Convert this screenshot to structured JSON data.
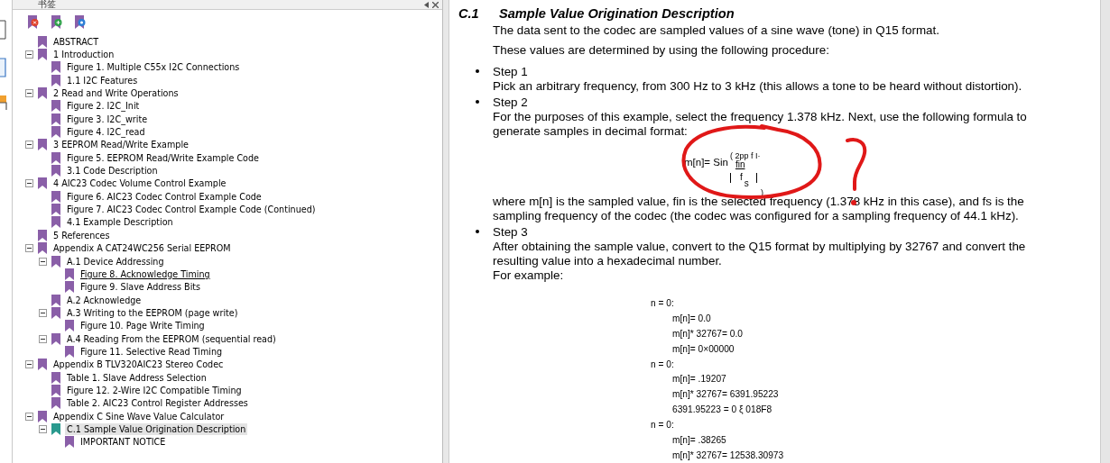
{
  "sidebar": {
    "title": "书签",
    "items": [
      {
        "label": "ABSTRACT",
        "selected": false,
        "hovered": false
      },
      {
        "label": "1 Introduction",
        "selected": false,
        "hovered": false,
        "expanded": true,
        "children": [
          {
            "label": "Figure 1. Multiple C55x I2C Connections",
            "selected": false,
            "hovered": false
          },
          {
            "label": "1.1 I2C Features",
            "selected": false,
            "hovered": false
          }
        ]
      },
      {
        "label": "2 Read and Write Operations",
        "selected": false,
        "hovered": false,
        "expanded": true,
        "children": [
          {
            "label": "Figure 2. I2C_Init",
            "selected": false,
            "hovered": false
          },
          {
            "label": "Figure 3. I2C_write",
            "selected": false,
            "hovered": false
          },
          {
            "label": "Figure 4. I2C_read",
            "selected": false,
            "hovered": false
          }
        ]
      },
      {
        "label": "3 EEPROM Read/Write Example",
        "selected": false,
        "hovered": false,
        "expanded": true,
        "children": [
          {
            "label": "Figure 5. EEPROM Read/Write Example Code",
            "selected": false,
            "hovered": false
          },
          {
            "label": "3.1 Code Description",
            "selected": false,
            "hovered": false
          }
        ]
      },
      {
        "label": "4 AIC23 Codec Volume Control Example",
        "selected": false,
        "hovered": false,
        "expanded": true,
        "children": [
          {
            "label": "Figure 6. AIC23 Codec Control Example Code",
            "selected": false,
            "hovered": false
          },
          {
            "label": "Figure 7. AIC23 Codec Control Example Code (Continued)",
            "selected": false,
            "hovered": false
          },
          {
            "label": "4.1 Example Description",
            "selected": false,
            "hovered": false
          }
        ]
      },
      {
        "label": "5 References",
        "selected": false,
        "hovered": false
      },
      {
        "label": "Appendix A CAT24WC256 Serial EEPROM",
        "selected": false,
        "hovered": false,
        "expanded": true,
        "children": [
          {
            "label": "A.1 Device Addressing",
            "selected": false,
            "hovered": false,
            "expanded": true,
            "children": [
              {
                "label": "Figure 8. Acknowledge Timing",
                "selected": false,
                "hovered": true
              },
              {
                "label": "Figure 9. Slave Address Bits",
                "selected": false,
                "hovered": false
              }
            ]
          },
          {
            "label": "A.2 Acknowledge",
            "selected": false,
            "hovered": false
          },
          {
            "label": "A.3 Writing to the EEPROM (page write)",
            "selected": false,
            "hovered": false,
            "expanded": true,
            "children": [
              {
                "label": "Figure 10. Page Write Timing",
                "selected": false,
                "hovered": false
              }
            ]
          },
          {
            "label": "A.4 Reading From the EEPROM (sequential read)",
            "selected": false,
            "hovered": false,
            "expanded": true,
            "children": [
              {
                "label": "Figure 11. Selective Read Timing",
                "selected": false,
                "hovered": false
              }
            ]
          }
        ]
      },
      {
        "label": "Appendix B TLV320AIC23 Stereo Codec",
        "selected": false,
        "hovered": false,
        "expanded": true,
        "children": [
          {
            "label": "Table 1. Slave Address Selection",
            "selected": false,
            "hovered": false
          },
          {
            "label": "Figure 12. 2-Wire I2C Compatible Timing",
            "selected": false,
            "hovered": false
          },
          {
            "label": "Table 2. AIC23 Control Register Addresses",
            "selected": false,
            "hovered": false
          }
        ]
      },
      {
        "label": "Appendix C Sine Wave Value Calculator",
        "selected": false,
        "hovered": false,
        "expanded": true,
        "children": [
          {
            "label": "C.1 Sample Value Origination Description",
            "selected": true,
            "hovered": false,
            "expanded": true,
            "children": [
              {
                "label": "IMPORTANT NOTICE",
                "selected": false,
                "hovered": false
              }
            ]
          }
        ]
      }
    ]
  },
  "document": {
    "section_number": "C.1",
    "section_title": "Sample Value Origination Description",
    "paragraphs": [
      "The data sent to the codec are sampled values of a sine wave (tone) in Q15 format.",
      "These values are determined by using the following procedure:"
    ],
    "steps": [
      {
        "title": "Step 1",
        "blocks": [
          {
            "kind": "text",
            "text": "Pick an arbitrary frequency, from 300 Hz to 3 kHz (this allows a tone to be heard without distortion)."
          }
        ]
      },
      {
        "title": "Step 2",
        "blocks": [
          {
            "kind": "text",
            "text": "For the purposes of this example, select the frequency 1.378 kHz. Next, use the following formula to generate samples in decimal format:"
          },
          {
            "kind": "formula",
            "lhs": "m[n]= Sin",
            "upper": "( 2pp f  I·",
            "numerator": "fin",
            "lower": "f",
            "subscript": "s",
            "close": ")"
          },
          {
            "kind": "text",
            "text": "where m[n] is the sampled value, fin is the selected frequency (1.378 kHz in this case), and fs is the sampling frequency of the codec (the codec was configured for a sampling frequency of 44.1 kHz)."
          }
        ]
      },
      {
        "title": "Step 3",
        "blocks": [
          {
            "kind": "text",
            "text": "After obtaining the sample value, convert to the Q15 format by multiplying by 32767 and convert the resulting value into a hexadecimal number."
          },
          {
            "kind": "text",
            "text": "For example:"
          },
          {
            "kind": "example",
            "groups": [
              {
                "head": "n = 0:",
                "lines": [
                  "m[n]= 0.0",
                  "m[n]* 32767= 0.0",
                  "m[n]= 0×00000"
                ]
              },
              {
                "head": "n = 0:",
                "lines": [
                  "m[n]= .19207",
                  "m[n]* 32767= 6391.95223",
                  "6391.95223 = 0 ξ 018F8"
                ]
              },
              {
                "head": "n = 0:",
                "lines": [
                  "m[n]= .38265",
                  "m[n]* 32767= 12538.30973"
                ]
              }
            ]
          }
        ]
      }
    ]
  }
}
